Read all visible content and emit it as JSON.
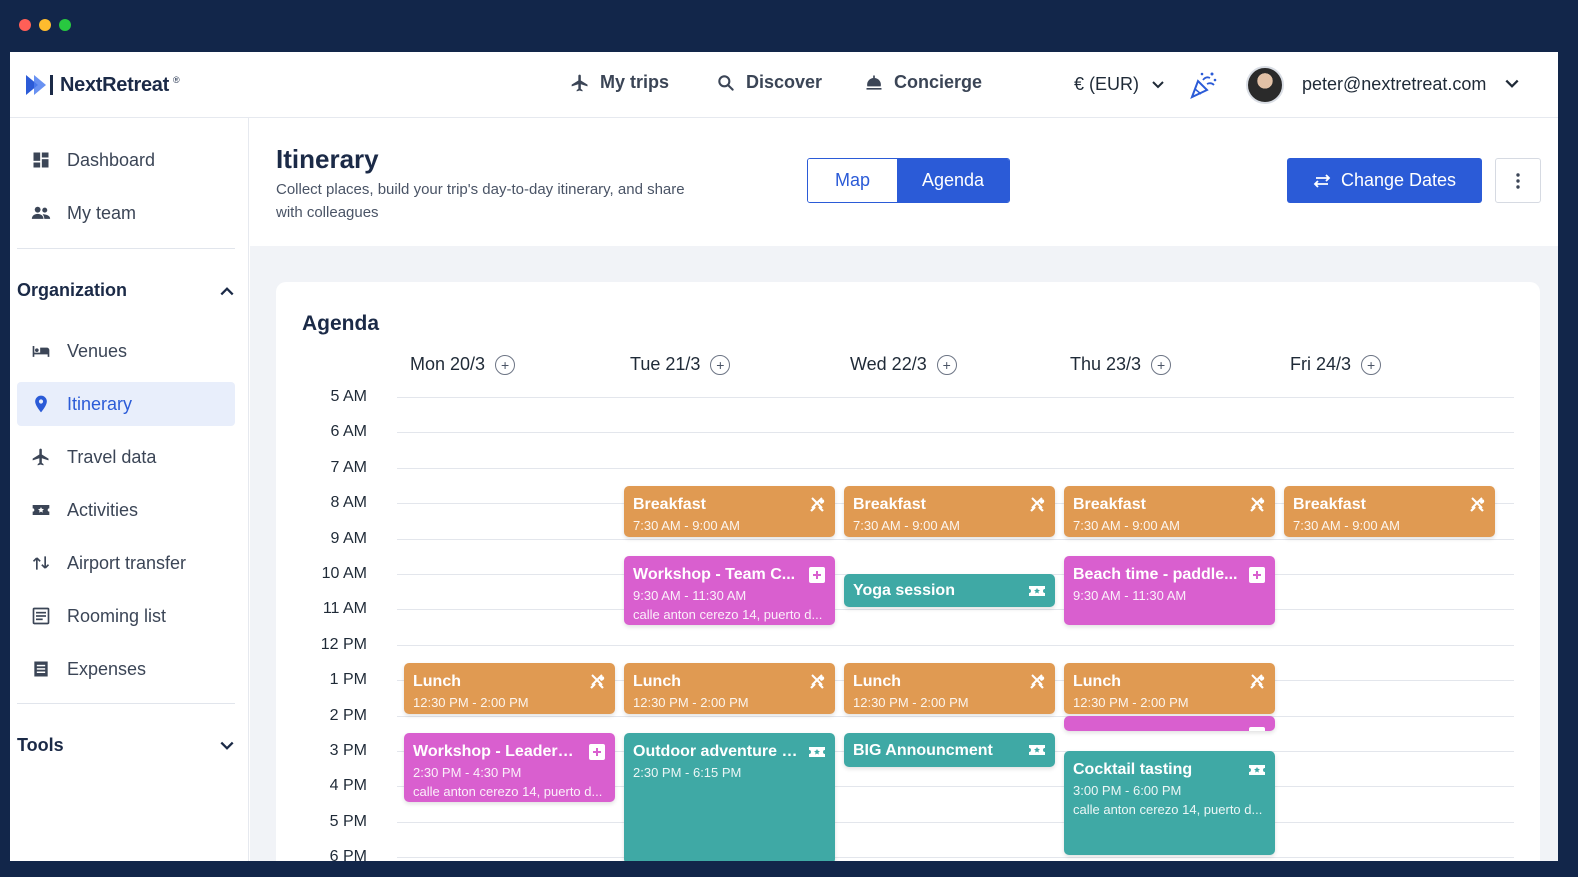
{
  "window": {
    "dot_colors": [
      "#ff5f57",
      "#febc2e",
      "#28c840"
    ]
  },
  "brand": {
    "name": "NextRetreat",
    "mark": "®",
    "color": "#2b5bd7"
  },
  "topnav": {
    "my_trips": "My trips",
    "discover": "Discover",
    "concierge": "Concierge",
    "currency": "€ (EUR)",
    "user_email": "peter@nextretreat.com"
  },
  "sidebar": {
    "top_items": [
      {
        "label": "Dashboard",
        "icon": "dashboard-icon"
      },
      {
        "label": "My team",
        "icon": "people-icon"
      }
    ],
    "organization": {
      "label": "Organization",
      "items": [
        {
          "label": "Venues",
          "icon": "bed-icon"
        },
        {
          "label": "Itinerary",
          "icon": "location-pin-icon",
          "active": true
        },
        {
          "label": "Travel data",
          "icon": "airplane-icon"
        },
        {
          "label": "Activities",
          "icon": "ticket-icon"
        },
        {
          "label": "Airport transfer",
          "icon": "transfer-icon"
        },
        {
          "label": "Rooming list",
          "icon": "list-icon"
        },
        {
          "label": "Expenses",
          "icon": "receipt-icon"
        }
      ]
    },
    "tools": {
      "label": "Tools"
    }
  },
  "header": {
    "title": "Itinerary",
    "subtitle": "Collect places, build your trip's day-to-day itinerary, and share with colleagues",
    "view_toggle": {
      "map": "Map",
      "agenda": "Agenda",
      "selected": "Agenda"
    },
    "change_dates": "Change Dates"
  },
  "agenda": {
    "title": "Agenda",
    "days": [
      "Mon 20/3",
      "Tue 21/3",
      "Wed 22/3",
      "Thu 23/3",
      "Fri 24/3"
    ],
    "hours": [
      "5 AM",
      "6 AM",
      "7 AM",
      "8 AM",
      "9 AM",
      "10 AM",
      "11 AM",
      "12 PM",
      "1 PM",
      "2 PM",
      "3 PM",
      "4 PM",
      "5 PM",
      "6 PM"
    ],
    "colors": {
      "meal": "#e09a52",
      "workshop": "#d95fcf",
      "activity": "#3fa9a5",
      "accent": "#2b5bd7"
    },
    "events": [
      {
        "day": 1,
        "title": "Breakfast",
        "time": "7:30 AM - 9:00 AM",
        "start": 7.5,
        "end": 9.0,
        "kind": "meal",
        "icon": "utensils-icon"
      },
      {
        "day": 2,
        "title": "Breakfast",
        "time": "7:30 AM - 9:00 AM",
        "start": 7.5,
        "end": 9.0,
        "kind": "meal",
        "icon": "utensils-icon"
      },
      {
        "day": 3,
        "title": "Breakfast",
        "time": "7:30 AM - 9:00 AM",
        "start": 7.5,
        "end": 9.0,
        "kind": "meal",
        "icon": "utensils-icon"
      },
      {
        "day": 4,
        "title": "Breakfast",
        "time": "7:30 AM - 9:00 AM",
        "start": 7.5,
        "end": 9.0,
        "kind": "meal",
        "icon": "utensils-icon"
      },
      {
        "day": 1,
        "title": "Workshop - Team C...",
        "time": "9:30 AM - 11:30 AM",
        "location": "calle anton cerezo 14, puerto d...",
        "start": 9.5,
        "end": 11.5,
        "kind": "workshop",
        "icon": "plus-box-icon"
      },
      {
        "day": 2,
        "title": "Yoga session",
        "time": "",
        "start": 10.0,
        "end": 11.0,
        "kind": "activity",
        "icon": "ticket-icon"
      },
      {
        "day": 3,
        "title": "Beach time - paddle...",
        "time": "9:30 AM - 11:30 AM",
        "start": 9.5,
        "end": 11.5,
        "kind": "workshop",
        "icon": "plus-box-icon"
      },
      {
        "day": 0,
        "title": "Lunch",
        "time": "12:30 PM - 2:00 PM",
        "start": 12.5,
        "end": 14.0,
        "kind": "meal",
        "icon": "utensils-icon"
      },
      {
        "day": 1,
        "title": "Lunch",
        "time": "12:30 PM - 2:00 PM",
        "start": 12.5,
        "end": 14.0,
        "kind": "meal",
        "icon": "utensils-icon"
      },
      {
        "day": 2,
        "title": "Lunch",
        "time": "12:30 PM - 2:00 PM",
        "start": 12.5,
        "end": 14.0,
        "kind": "meal",
        "icon": "utensils-icon"
      },
      {
        "day": 3,
        "title": "Lunch",
        "time": "12:30 PM - 2:00 PM",
        "start": 12.5,
        "end": 14.0,
        "kind": "meal",
        "icon": "utensils-icon"
      },
      {
        "day": 3,
        "title": "",
        "time": "",
        "start": 14.0,
        "end": 14.5,
        "kind": "workshop",
        "icon": "plus-box-icon"
      },
      {
        "day": 0,
        "title": "Workshop - Leaders...",
        "time": "2:30 PM - 4:30 PM",
        "location": "calle anton cerezo 14, puerto d...",
        "start": 14.5,
        "end": 16.5,
        "kind": "workshop",
        "icon": "plus-box-icon"
      },
      {
        "day": 1,
        "title": "Outdoor adventure -...",
        "time": "2:30 PM - 6:15 PM",
        "start": 14.5,
        "end": 18.25,
        "kind": "activity",
        "icon": "ticket-icon"
      },
      {
        "day": 2,
        "title": "BIG Announcment",
        "time": "",
        "start": 14.5,
        "end": 15.5,
        "kind": "activity",
        "icon": "ticket-icon"
      },
      {
        "day": 3,
        "title": "Cocktail tasting",
        "time": "3:00 PM - 6:00 PM",
        "location": "calle anton cerezo 14, puerto d...",
        "start": 15.0,
        "end": 18.0,
        "kind": "activity",
        "icon": "ticket-icon"
      }
    ]
  }
}
